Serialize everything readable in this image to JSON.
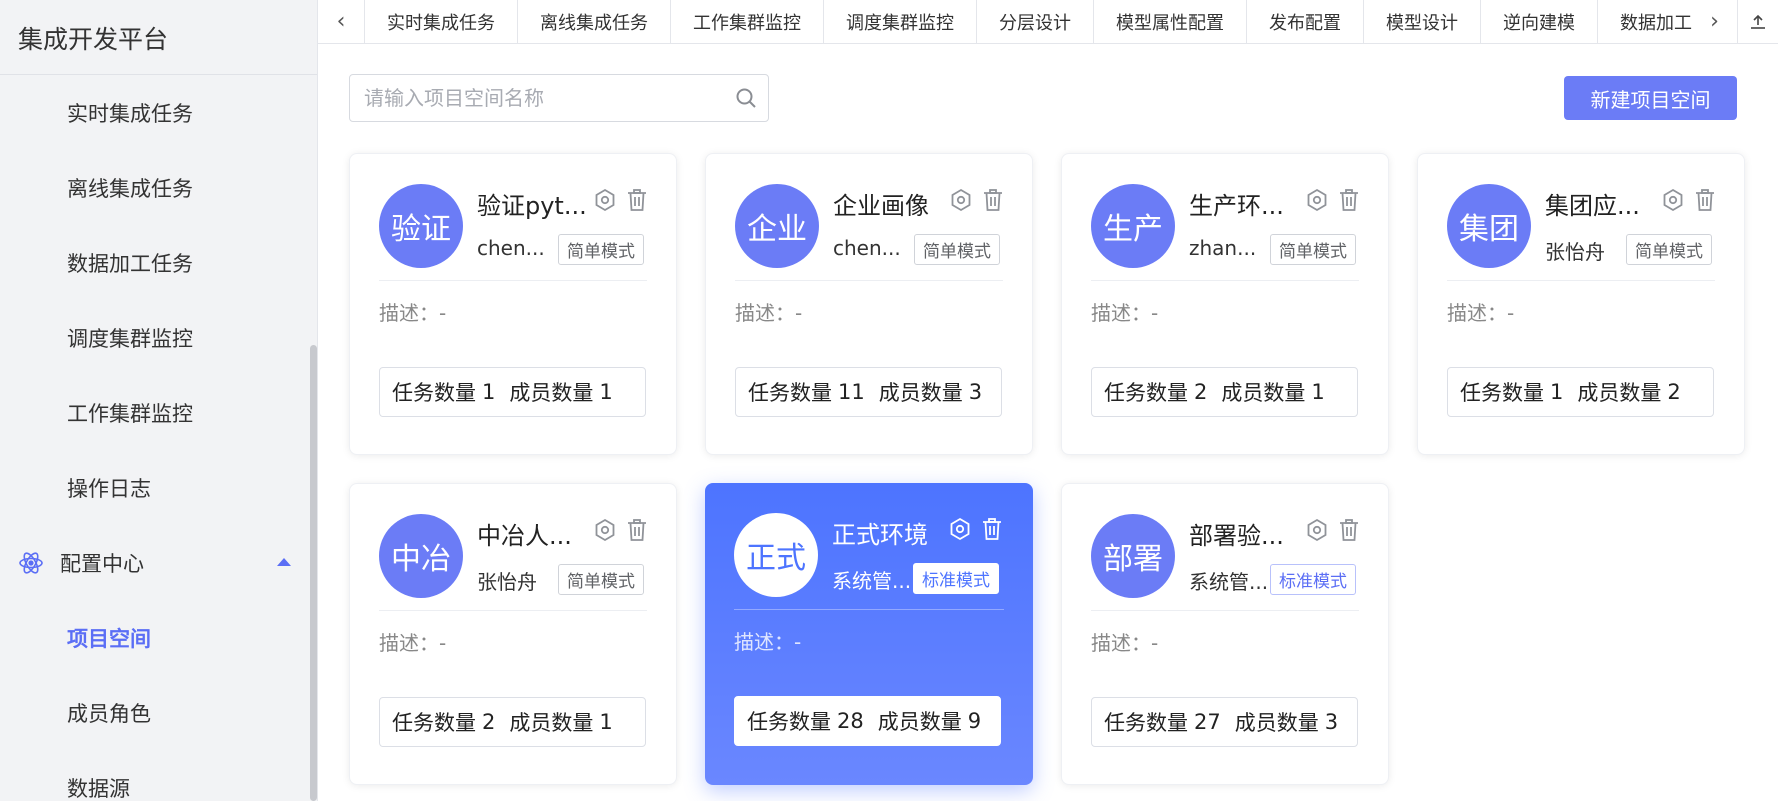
{
  "app": {
    "title": "集成开发平台"
  },
  "sidebar": {
    "items": [
      {
        "label": "实时集成任务"
      },
      {
        "label": "离线集成任务"
      },
      {
        "label": "数据加工任务"
      },
      {
        "label": "调度集群监控"
      },
      {
        "label": "工作集群监控"
      },
      {
        "label": "操作日志"
      }
    ],
    "group": {
      "label": "配置中心",
      "icon": "atom-icon"
    },
    "sub_items": [
      {
        "label": "项目空间",
        "active": true
      },
      {
        "label": "成员角色"
      },
      {
        "label": "数据源"
      }
    ]
  },
  "tabs": [
    {
      "label": "实时集成任务"
    },
    {
      "label": "离线集成任务"
    },
    {
      "label": "工作集群监控"
    },
    {
      "label": "调度集群监控"
    },
    {
      "label": "分层设计"
    },
    {
      "label": "模型属性配置"
    },
    {
      "label": "发布配置"
    },
    {
      "label": "模型设计"
    },
    {
      "label": "逆向建模"
    },
    {
      "label": "数据加工任"
    }
  ],
  "search": {
    "placeholder": "请输入项目空间名称"
  },
  "toolbar": {
    "new_label": "新建项目空间"
  },
  "cards": [
    {
      "avatar": "验证",
      "title": "验证pyt...",
      "owner": "chen...",
      "mode": "简单模式",
      "desc": "描述：-",
      "stats": {
        "task_label": "任务数量",
        "task_count": "1",
        "member_label": "成员数量",
        "member_count": "1"
      }
    },
    {
      "avatar": "企业",
      "title": "企业画像",
      "owner": "chen...",
      "mode": "简单模式",
      "desc": "描述：-",
      "stats": {
        "task_label": "任务数量",
        "task_count": "11",
        "member_label": "成员数量",
        "member_count": "3"
      }
    },
    {
      "avatar": "生产",
      "title": "生产环...",
      "owner": "zhan...",
      "mode": "简单模式",
      "desc": "描述：-",
      "stats": {
        "task_label": "任务数量",
        "task_count": "2",
        "member_label": "成员数量",
        "member_count": "1"
      }
    },
    {
      "avatar": "集团",
      "title": "集团应...",
      "owner": "张怡舟",
      "mode": "简单模式",
      "desc": "描述：-",
      "stats": {
        "task_label": "任务数量",
        "task_count": "1",
        "member_label": "成员数量",
        "member_count": "2"
      }
    },
    {
      "avatar": "中冶",
      "title": "中冶人...",
      "owner": "张怡舟",
      "mode": "简单模式",
      "desc": "描述：-",
      "stats": {
        "task_label": "任务数量",
        "task_count": "2",
        "member_label": "成员数量",
        "member_count": "1"
      }
    },
    {
      "avatar": "正式",
      "title": "正式环境",
      "owner": "系统管...",
      "mode": "标准模式",
      "desc": "描述：-",
      "stats": {
        "task_label": "任务数量",
        "task_count": "28",
        "member_label": "成员数量",
        "member_count": "9"
      }
    },
    {
      "avatar": "部署",
      "title": "部署验...",
      "owner": "系统管...",
      "mode": "标准模式",
      "desc": "描述：-",
      "stats": {
        "task_label": "任务数量",
        "task_count": "27",
        "member_label": "成员数量",
        "member_count": "3"
      }
    }
  ],
  "colors": {
    "accent": "#6b7cf6",
    "highlight": "#4d74ff"
  }
}
